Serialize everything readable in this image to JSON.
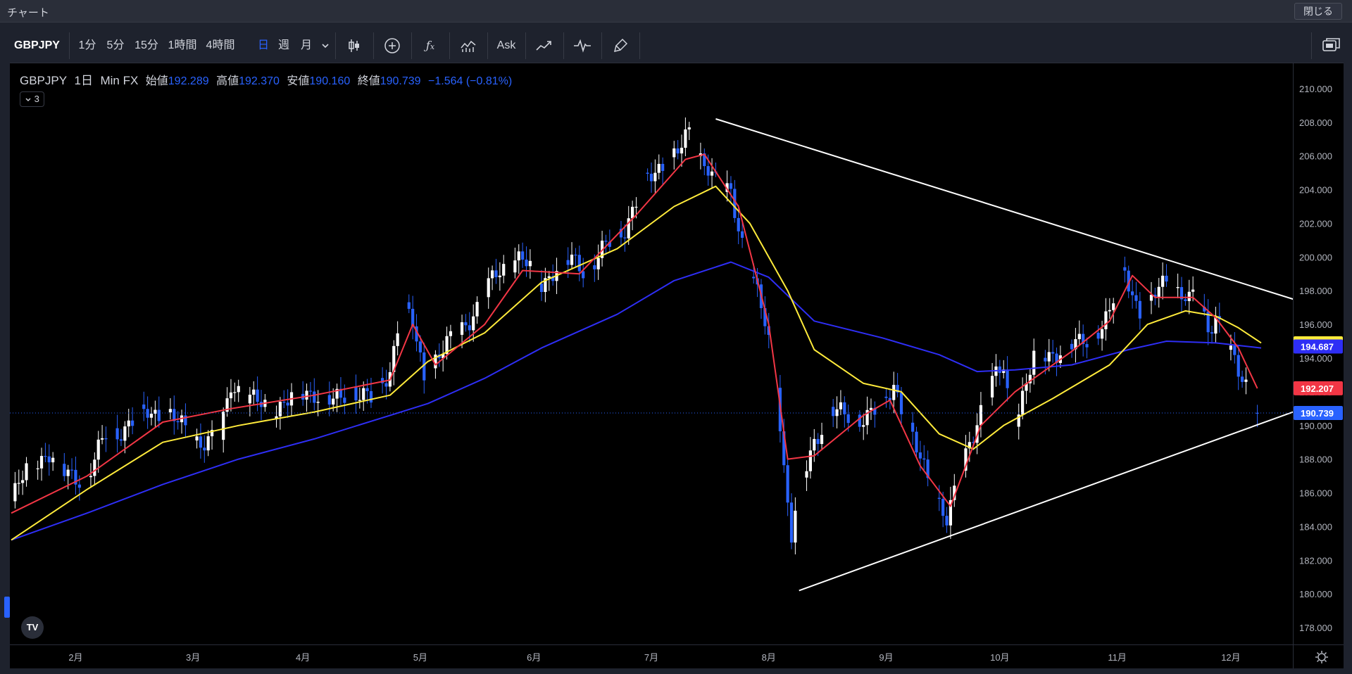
{
  "window": {
    "title": "チャート",
    "close_label": "閉じる"
  },
  "toolbar": {
    "symbol": "GBPJPY",
    "intervals": [
      "1分",
      "5分",
      "15分",
      "1時間",
      "4時間",
      "日",
      "週",
      "月"
    ],
    "active_interval": "日",
    "ask_label": "Ask",
    "colors": {
      "active": "#2962ff",
      "text": "#d1d4dc"
    },
    "icons": [
      "chevron-down-icon",
      "candles-icon",
      "add-icon",
      "indicator-icon",
      "compare-icon",
      "ask-icon",
      "trend-icon",
      "wave-icon",
      "brush-icon",
      "layout-icon"
    ]
  },
  "legend": {
    "symbol": "GBPJPY",
    "interval": "1日",
    "broker": "Min FX",
    "open_label": "始値",
    "open": "192.289",
    "high_label": "高値",
    "high": "192.370",
    "low_label": "安値",
    "low": "190.160",
    "close_label": "終値",
    "close": "190.739",
    "change": "−1.564 (−0.81%)",
    "collapse_label": "3"
  },
  "chart_data": {
    "type": "candlestick",
    "ylim": [
      177.0,
      211.5
    ],
    "y_ticks": [
      "178.000",
      "180.000",
      "182.000",
      "184.000",
      "186.000",
      "188.000",
      "190.000",
      "192.000",
      "194.000",
      "196.000",
      "198.000",
      "200.000",
      "202.000",
      "204.000",
      "206.000",
      "208.000",
      "210.000"
    ],
    "y_tick_values": [
      178,
      180,
      182,
      184,
      186,
      188,
      190,
      192,
      194,
      196,
      198,
      200,
      202,
      204,
      206,
      208,
      210
    ],
    "x_ticks": [
      "2月",
      "3月",
      "4月",
      "5月",
      "6月",
      "7月",
      "8月",
      "9月",
      "10月",
      "11月",
      "12月"
    ],
    "x_tick_days": [
      17,
      48,
      77,
      108,
      138,
      169,
      200,
      231,
      261,
      292,
      322
    ],
    "x_range_days": [
      0,
      338
    ],
    "colors": {
      "up": "#ffffff",
      "down": "#2962ff",
      "ma_fast": "#f23645",
      "ma_mid": "#ffeb3b",
      "ma_slow": "#2e2ef5",
      "trendline": "#ffffff"
    },
    "ohlc_anchors": [
      [
        0,
        185.5
      ],
      [
        5,
        187.8
      ],
      [
        10,
        188.3
      ],
      [
        14,
        187.2
      ],
      [
        20,
        186.8
      ],
      [
        25,
        189.5
      ],
      [
        30,
        189.8
      ],
      [
        36,
        190.9
      ],
      [
        42,
        190.5
      ],
      [
        46,
        189.8
      ],
      [
        50,
        189.0
      ],
      [
        55,
        189.2
      ],
      [
        58,
        192.6
      ],
      [
        63,
        191.5
      ],
      [
        70,
        191.0
      ],
      [
        75,
        191.8
      ],
      [
        80,
        192.0
      ],
      [
        85,
        191.3
      ],
      [
        90,
        192.2
      ],
      [
        95,
        191.5
      ],
      [
        100,
        193.3
      ],
      [
        103,
        197.2
      ],
      [
        106,
        196.0
      ],
      [
        109,
        192.8
      ],
      [
        112,
        194.0
      ],
      [
        118,
        195.5
      ],
      [
        123,
        197.0
      ],
      [
        128,
        199.0
      ],
      [
        133,
        200.0
      ],
      [
        136,
        199.6
      ],
      [
        140,
        198.4
      ],
      [
        143,
        199.2
      ],
      [
        148,
        199.8
      ],
      [
        152,
        199.2
      ],
      [
        156,
        200.3
      ],
      [
        162,
        201.8
      ],
      [
        167,
        204.3
      ],
      [
        172,
        205.5
      ],
      [
        177,
        206.5
      ],
      [
        179,
        207.3
      ],
      [
        181,
        206.2
      ],
      [
        184,
        205.5
      ],
      [
        187,
        204.0
      ],
      [
        190,
        203.7
      ],
      [
        193,
        201.0
      ],
      [
        196,
        198.6
      ],
      [
        199,
        196.0
      ],
      [
        202,
        192.8
      ],
      [
        204,
        187.5
      ],
      [
        206,
        183.5
      ],
      [
        208,
        186.0
      ],
      [
        212,
        189.0
      ],
      [
        216,
        191.0
      ],
      [
        220,
        190.5
      ],
      [
        224,
        190.5
      ],
      [
        230,
        191.0
      ],
      [
        233,
        192.5
      ],
      [
        236,
        190.5
      ],
      [
        239,
        188.5
      ],
      [
        242,
        186.8
      ],
      [
        245,
        185.5
      ],
      [
        247,
        184.5
      ],
      [
        250,
        186.5
      ],
      [
        253,
        189.0
      ],
      [
        256,
        191.0
      ],
      [
        259,
        192.5
      ],
      [
        262,
        193.5
      ],
      [
        264,
        190.3
      ],
      [
        266,
        191.0
      ],
      [
        270,
        194.0
      ],
      [
        274,
        194.2
      ],
      [
        278,
        194.6
      ],
      [
        282,
        194.8
      ],
      [
        286,
        195.5
      ],
      [
        290,
        196.5
      ],
      [
        292,
        198.3
      ],
      [
        294,
        199.4
      ],
      [
        296,
        197.8
      ],
      [
        299,
        196.3
      ],
      [
        302,
        197.8
      ],
      [
        305,
        198.8
      ],
      [
        308,
        198.0
      ],
      [
        311,
        197.3
      ],
      [
        313,
        197.8
      ],
      [
        316,
        195.8
      ],
      [
        318,
        196.6
      ],
      [
        321,
        194.6
      ],
      [
        324,
        193.2
      ],
      [
        327,
        192.2
      ],
      [
        329,
        190.7
      ]
    ],
    "ma_fast": [
      [
        0,
        184.8
      ],
      [
        20,
        187.0
      ],
      [
        40,
        190.2
      ],
      [
        58,
        191.0
      ],
      [
        80,
        191.8
      ],
      [
        100,
        192.7
      ],
      [
        106,
        196.0
      ],
      [
        112,
        193.6
      ],
      [
        125,
        196.0
      ],
      [
        135,
        199.2
      ],
      [
        150,
        199.0
      ],
      [
        165,
        202.5
      ],
      [
        178,
        205.8
      ],
      [
        183,
        206.1
      ],
      [
        192,
        203.0
      ],
      [
        200,
        196.0
      ],
      [
        205,
        188.0
      ],
      [
        212,
        188.2
      ],
      [
        225,
        190.6
      ],
      [
        232,
        191.5
      ],
      [
        240,
        187.6
      ],
      [
        248,
        185.2
      ],
      [
        256,
        190.0
      ],
      [
        265,
        192.0
      ],
      [
        280,
        194.4
      ],
      [
        290,
        196.2
      ],
      [
        296,
        198.9
      ],
      [
        302,
        197.6
      ],
      [
        312,
        197.6
      ],
      [
        318,
        196.4
      ],
      [
        324,
        194.6
      ],
      [
        329,
        192.2
      ]
    ],
    "ma_mid": [
      [
        0,
        183.2
      ],
      [
        20,
        186.2
      ],
      [
        40,
        189.0
      ],
      [
        60,
        190.0
      ],
      [
        80,
        190.8
      ],
      [
        100,
        191.8
      ],
      [
        110,
        193.8
      ],
      [
        125,
        195.5
      ],
      [
        140,
        198.5
      ],
      [
        160,
        200.5
      ],
      [
        175,
        203.0
      ],
      [
        186,
        204.2
      ],
      [
        195,
        202.0
      ],
      [
        205,
        198.0
      ],
      [
        212,
        194.5
      ],
      [
        225,
        192.5
      ],
      [
        235,
        192.0
      ],
      [
        245,
        189.5
      ],
      [
        254,
        188.6
      ],
      [
        262,
        190.0
      ],
      [
        275,
        191.6
      ],
      [
        290,
        193.6
      ],
      [
        300,
        196.0
      ],
      [
        310,
        196.8
      ],
      [
        318,
        196.5
      ],
      [
        324,
        195.8
      ],
      [
        330,
        194.9
      ]
    ],
    "ma_slow": [
      [
        0,
        183.2
      ],
      [
        20,
        184.8
      ],
      [
        40,
        186.5
      ],
      [
        60,
        188.0
      ],
      [
        80,
        189.2
      ],
      [
        100,
        190.6
      ],
      [
        110,
        191.3
      ],
      [
        125,
        192.8
      ],
      [
        140,
        194.6
      ],
      [
        160,
        196.6
      ],
      [
        175,
        198.6
      ],
      [
        190,
        199.7
      ],
      [
        200,
        198.8
      ],
      [
        212,
        196.2
      ],
      [
        230,
        195.2
      ],
      [
        245,
        194.2
      ],
      [
        255,
        193.2
      ],
      [
        265,
        193.3
      ],
      [
        280,
        193.6
      ],
      [
        295,
        194.5
      ],
      [
        305,
        195.0
      ],
      [
        318,
        194.9
      ],
      [
        330,
        194.6
      ]
    ],
    "trendlines": [
      {
        "start": [
          186,
          208.2
        ],
        "end": [
          347,
          196.9
        ]
      },
      {
        "start": [
          208,
          180.2
        ],
        "end": [
          347,
          191.5
        ]
      }
    ],
    "current_price": 190.739,
    "price_labels": [
      {
        "value": 194.875,
        "text": "194.875",
        "bg": "#ffeb3b",
        "fg": "#000000"
      },
      {
        "value": 194.687,
        "text": "194.687",
        "bg": "#2e2ef5",
        "fg": "#ffffff"
      },
      {
        "value": 192.207,
        "text": "192.207",
        "bg": "#f23645",
        "fg": "#ffffff"
      },
      {
        "value": 190.739,
        "text": "190.739",
        "bg": "#2962ff",
        "fg": "#ffffff"
      }
    ]
  }
}
